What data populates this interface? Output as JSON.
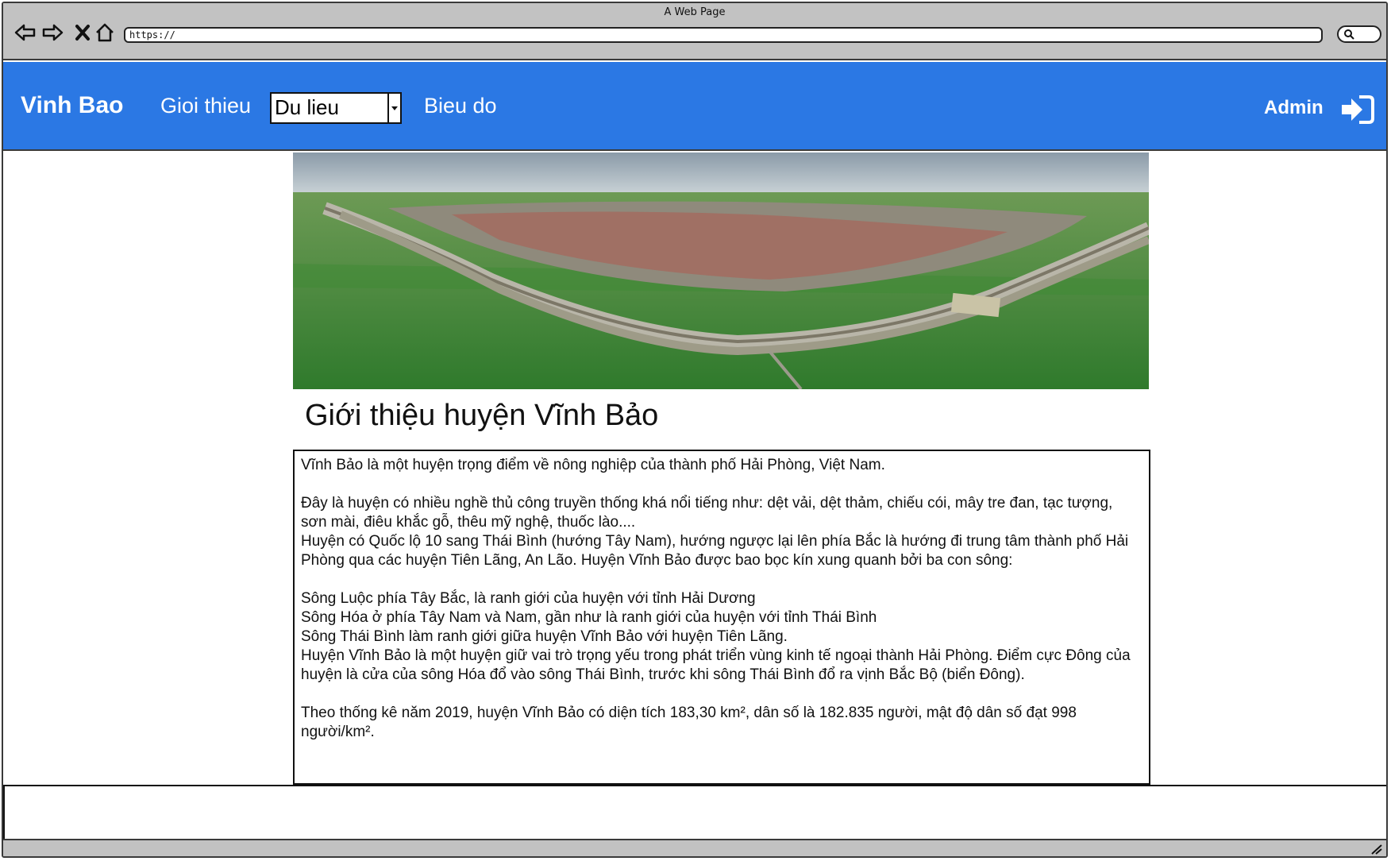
{
  "window": {
    "title": "A Web Page"
  },
  "browser": {
    "url": "https://",
    "icons": [
      "back-icon",
      "forward-icon",
      "close-icon",
      "home-icon",
      "search-icon"
    ]
  },
  "nav": {
    "brand": "Vinh Bao",
    "intro_link": "Gioi thieu",
    "data_select": {
      "selected": "Du lieu"
    },
    "chart_link": "Bieu do",
    "admin_label": "Admin",
    "login_icon": "sign-in-icon",
    "background_color": "#2b78e4"
  },
  "hero": {
    "image": "aerial-landscape-photo"
  },
  "content": {
    "title": "Giới thiệu huyện Vĩnh Bảo",
    "paragraphs": [
      "Vĩnh Bảo là một huyện trọng điểm về nông nghiệp của thành phố Hải Phòng, Việt Nam.",
      "Đây là huyện có nhiều nghề thủ công truyền thống khá nổi tiếng như: dệt vải, dệt thảm, chiếu cói, mây tre đan, tạc tượng, sơn mài, điêu khắc gỗ, thêu mỹ nghệ, thuốc lào....",
      "Huyện có Quốc lộ 10 sang Thái Bình (hướng Tây Nam), hướng ngược lại lên phía Bắc là hướng đi trung tâm thành phố Hải Phòng qua các huyện Tiên Lãng, An Lão. Huyện Vĩnh Bảo được bao bọc kín xung quanh bởi ba con sông:",
      "Sông Luộc phía Tây Bắc, là ranh giới của huyện với tỉnh Hải Dương",
      "Sông Hóa ở phía Tây Nam và Nam, gần như là ranh giới của huyện với tỉnh Thái Bình",
      "Sông Thái Bình làm ranh giới giữa huyện Vĩnh Bảo với huyện Tiên Lãng.",
      "Huyện Vĩnh Bảo là một huyện giữ vai trò trọng yếu trong phát triển vùng kinh tế ngoại thành Hải Phòng. Điểm cực Đông của huyện là cửa của sông Hóa đổ vào sông Thái Bình, trước khi sông Thái Bình đổ ra vịnh Bắc Bộ (biển Đông).",
      "Theo thống kê năm 2019, huyện Vĩnh Bảo có diện tích 183,30 km², dân số là 182.835 người, mật độ dân số đạt 998 người/km²."
    ]
  }
}
